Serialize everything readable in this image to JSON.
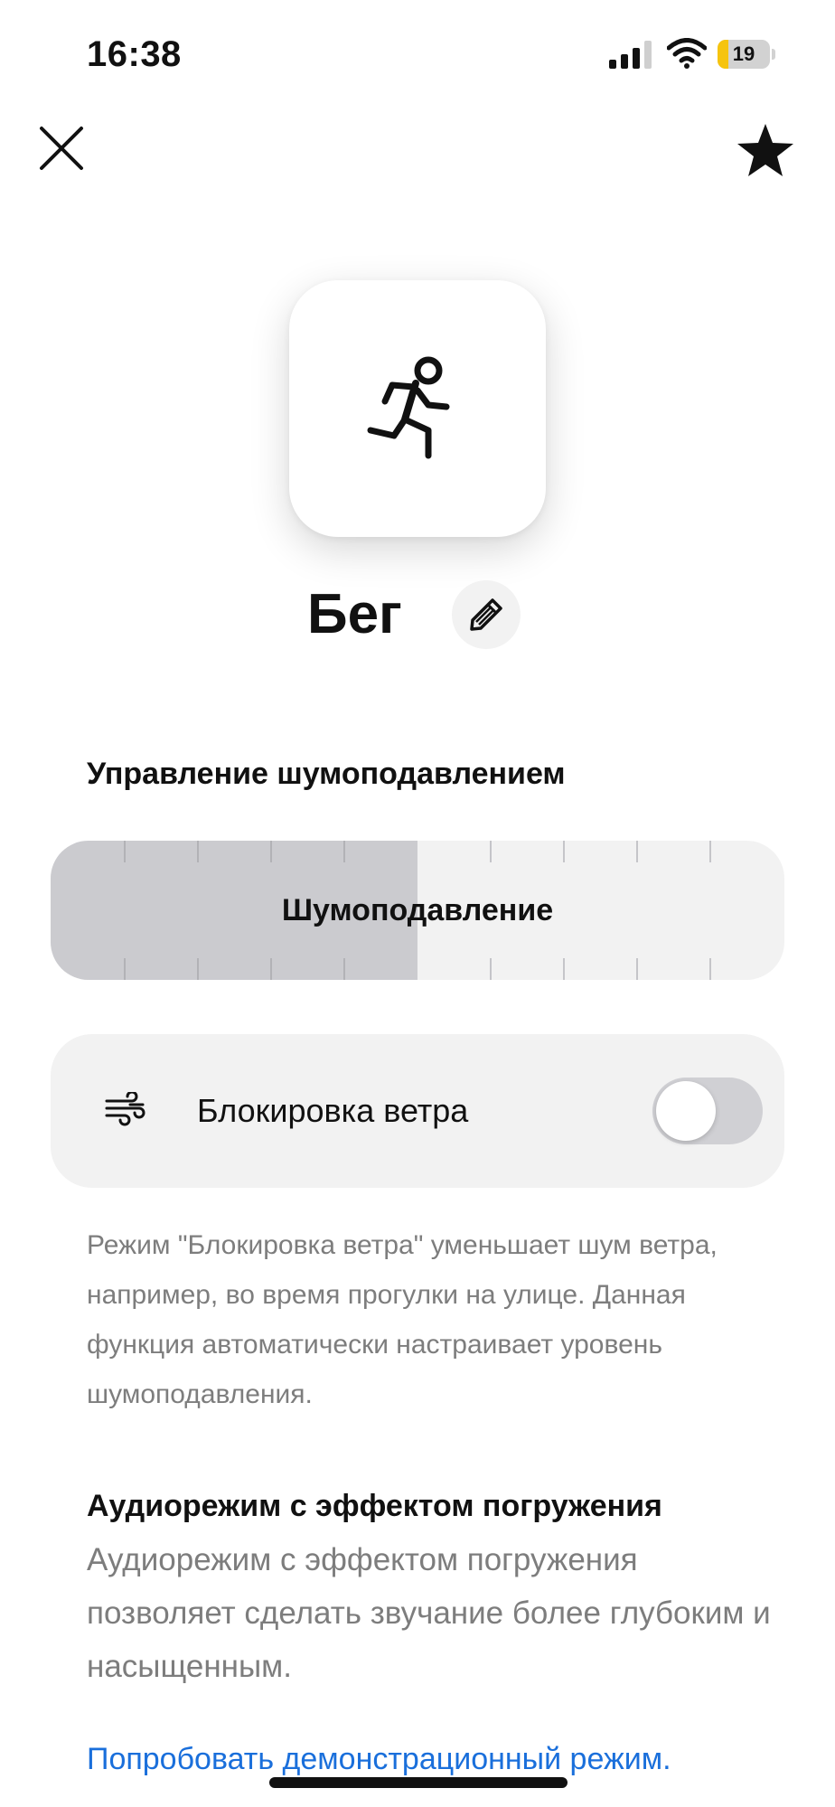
{
  "status_bar": {
    "time": "16:38",
    "battery_level": "19",
    "battery_color": "#f6c40f",
    "icons": [
      "signal-icon",
      "wifi-icon",
      "battery-icon"
    ]
  },
  "nav": {
    "close_icon": "close-icon",
    "favorite_icon": "star-icon"
  },
  "mode": {
    "icon": "running-person-icon",
    "title": "Бег",
    "edit_icon": "pencil-icon"
  },
  "noise_control": {
    "heading": "Управление шумоподавлением",
    "slider_label": "Шумоподавление",
    "level_fraction": 0.5
  },
  "wind_block": {
    "icon": "wind-icon",
    "label": "Блокировка ветра",
    "enabled": false,
    "description": "Режим \"Блокировка ветра\" уменьшает шум ветра, например, во время прогулки на улице. Данная функция автоматически настраивает уровень шумоподавления."
  },
  "immersive": {
    "title": "Аудиорежим с эффектом погружения",
    "description": "Аудиорежим с эффектом погружения позволяет сделать звучание более глубоким и насыщенным.",
    "link": "Попробовать демонстрационный режим."
  },
  "colors": {
    "accent_link": "#1a6fdb",
    "card_background": "#f2f2f2",
    "slider_fill": "#cbcbcf"
  }
}
